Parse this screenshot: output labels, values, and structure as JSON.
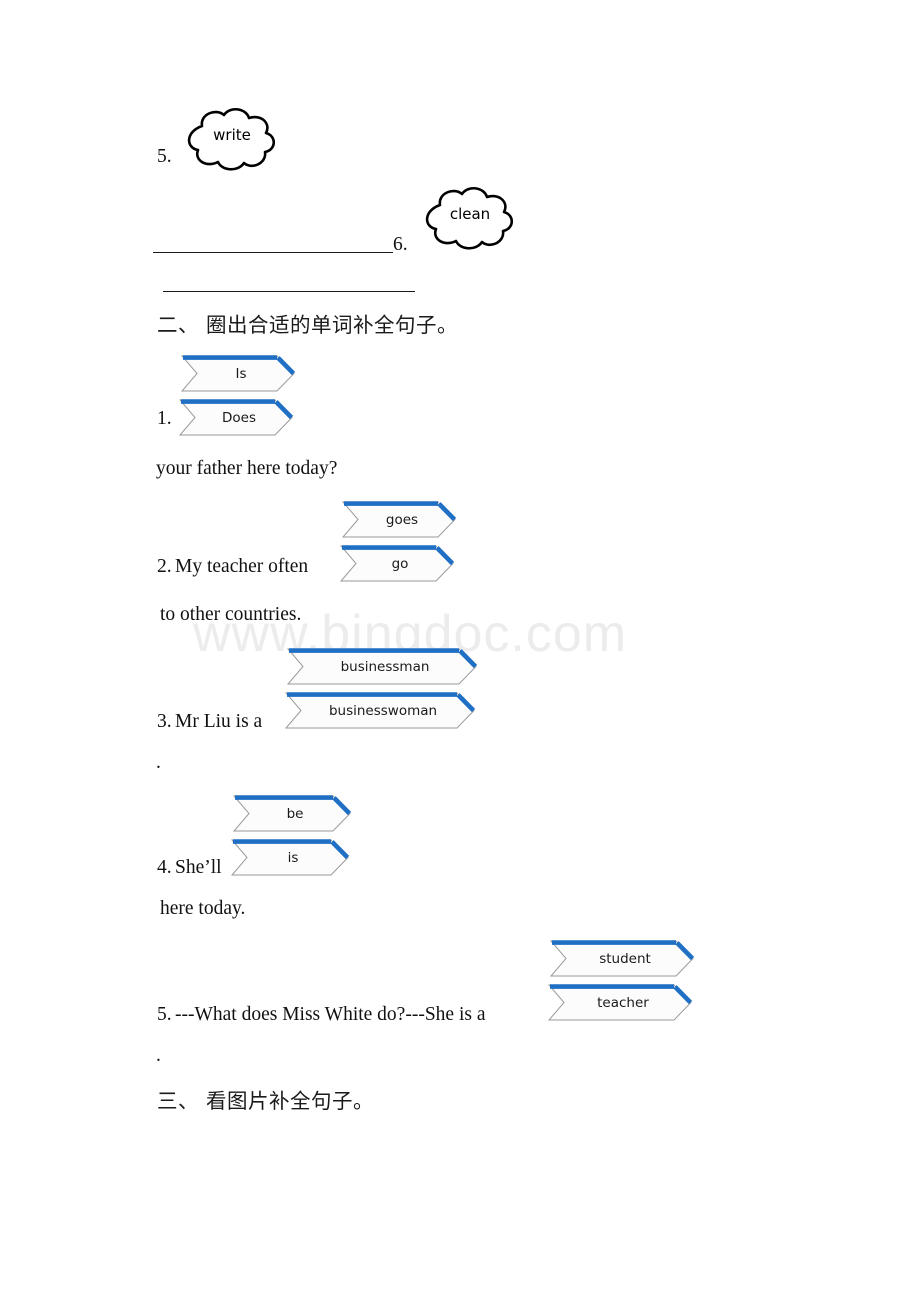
{
  "watermark": {
    "text": "www.bingdoc.com",
    "color": "#ececed"
  },
  "theme": {
    "banner_blue": "#1f6fc4",
    "banner_outline": "#9a9a9a",
    "ink": "#111111"
  },
  "section_one_tail": {
    "items": [
      {
        "number": "5.",
        "word": "write"
      },
      {
        "number": "6.",
        "word": "clean"
      }
    ],
    "blank_lines": 2
  },
  "section_two": {
    "heading": "二、 圈出合适的单词补全句子。",
    "questions": [
      {
        "number": "1.",
        "options": [
          "Is",
          "Does"
        ],
        "text_before": "",
        "text_after": "your father here today?",
        "trailing_period": false
      },
      {
        "number": "2.",
        "options": [
          "goes",
          "go"
        ],
        "text_before": "My teacher often",
        "text_after": "to other countries.",
        "trailing_period": false
      },
      {
        "number": "3.",
        "options": [
          "businessman",
          "businesswoman"
        ],
        "text_before": "Mr Liu is a",
        "text_after": "",
        "trailing_period": true
      },
      {
        "number": "4.",
        "options": [
          "be",
          "is"
        ],
        "text_before": "She’ll",
        "text_after": "here today.",
        "trailing_period": false
      },
      {
        "number": "5.",
        "options": [
          "student",
          "teacher"
        ],
        "text_before": "---What does Miss White do?---She is a",
        "text_after": "",
        "trailing_period": true
      }
    ]
  },
  "section_three": {
    "heading": "三、 看图片补全句子。"
  }
}
